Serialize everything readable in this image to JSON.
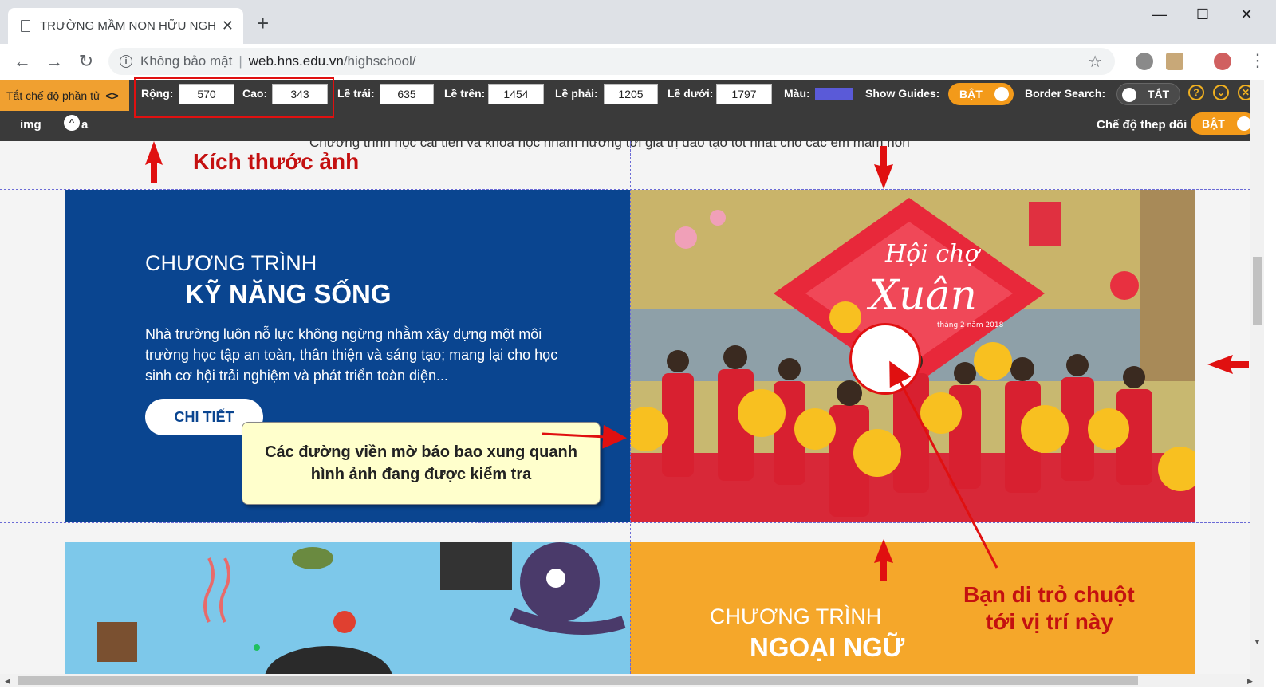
{
  "browser": {
    "tab_title": "TRƯỜNG MẦM NON HỮU NGHỊ",
    "tab_close": "✕",
    "new_tab": "+",
    "window_controls": {
      "minimize": "—",
      "maximize": "☐",
      "close": "✕"
    },
    "nav": {
      "back": "←",
      "forward": "→",
      "reload": "↻"
    },
    "security_label": "Không bảo mật",
    "url_host": "web.hns.edu.vn",
    "url_path": "/highschool/",
    "bookmark_icon": "☆",
    "menu": "⋮"
  },
  "extension": {
    "mode_label": "Tắt chế độ phần tử",
    "mode_arrows": "<>",
    "width_label": "Rộng:",
    "width_value": "570",
    "height_label": "Cao:",
    "height_value": "343",
    "left_label": "Lề trái:",
    "left_value": "635",
    "top_label": "Lề trên:",
    "top_value": "1454",
    "right_label": "Lề phải:",
    "right_value": "1205",
    "bottom_label": "Lề dưới:",
    "bottom_value": "1797",
    "color_label": "Màu:",
    "color_value": "#5a5ad8",
    "guides_label": "Show Guides:",
    "guides_state": "BẬT",
    "border_label": "Border Search:",
    "border_state": "TẮT",
    "help_icon": "?",
    "collapse_icon": "⌄",
    "close_icon": "✕",
    "tag_name": "img",
    "tag_icon": "^",
    "tag_suffix": "a",
    "track_label": "Chế độ thep dõi",
    "track_state": "BẬT"
  },
  "page": {
    "subtitle": "Chương trình học cải tiến và khóa học nhắm hướng tới giá trị đào tạo tốt nhất cho các em mầm non",
    "program1_label": "CHƯƠNG TRÌNH",
    "program1_name": "KỸ NĂNG SỐNG",
    "program1_desc": "Nhà trường luôn nỗ lực không ngừng nhằm xây dựng một môi trường học tập an toàn, thân thiện và sáng tạo; mang lại cho học sinh cơ hội trải nghiệm và phát triển toàn diện...",
    "program1_button": "CHI TIẾT",
    "program2_label": "CHƯƠNG TRÌNH",
    "program2_name": "NGOẠI NGỮ",
    "photo_sign_line1": "Hội chợ",
    "photo_sign_line2": "Xuân",
    "photo_sign_date": "tháng 2 năm 2018"
  },
  "annotations": {
    "image_size": "Kích thước ảnh",
    "callout": "Các đường viền mờ báo bao xung quanh hình ảnh đang được kiểm tra",
    "cursor_line1": "Bạn di trỏ chuột",
    "cursor_line2": "tới vị trí này"
  },
  "colors": {
    "program_blue": "#0a4590",
    "program_orange": "#f5a72a",
    "toolbar_accent": "#f39a1a",
    "annotation_red": "#c41010"
  }
}
